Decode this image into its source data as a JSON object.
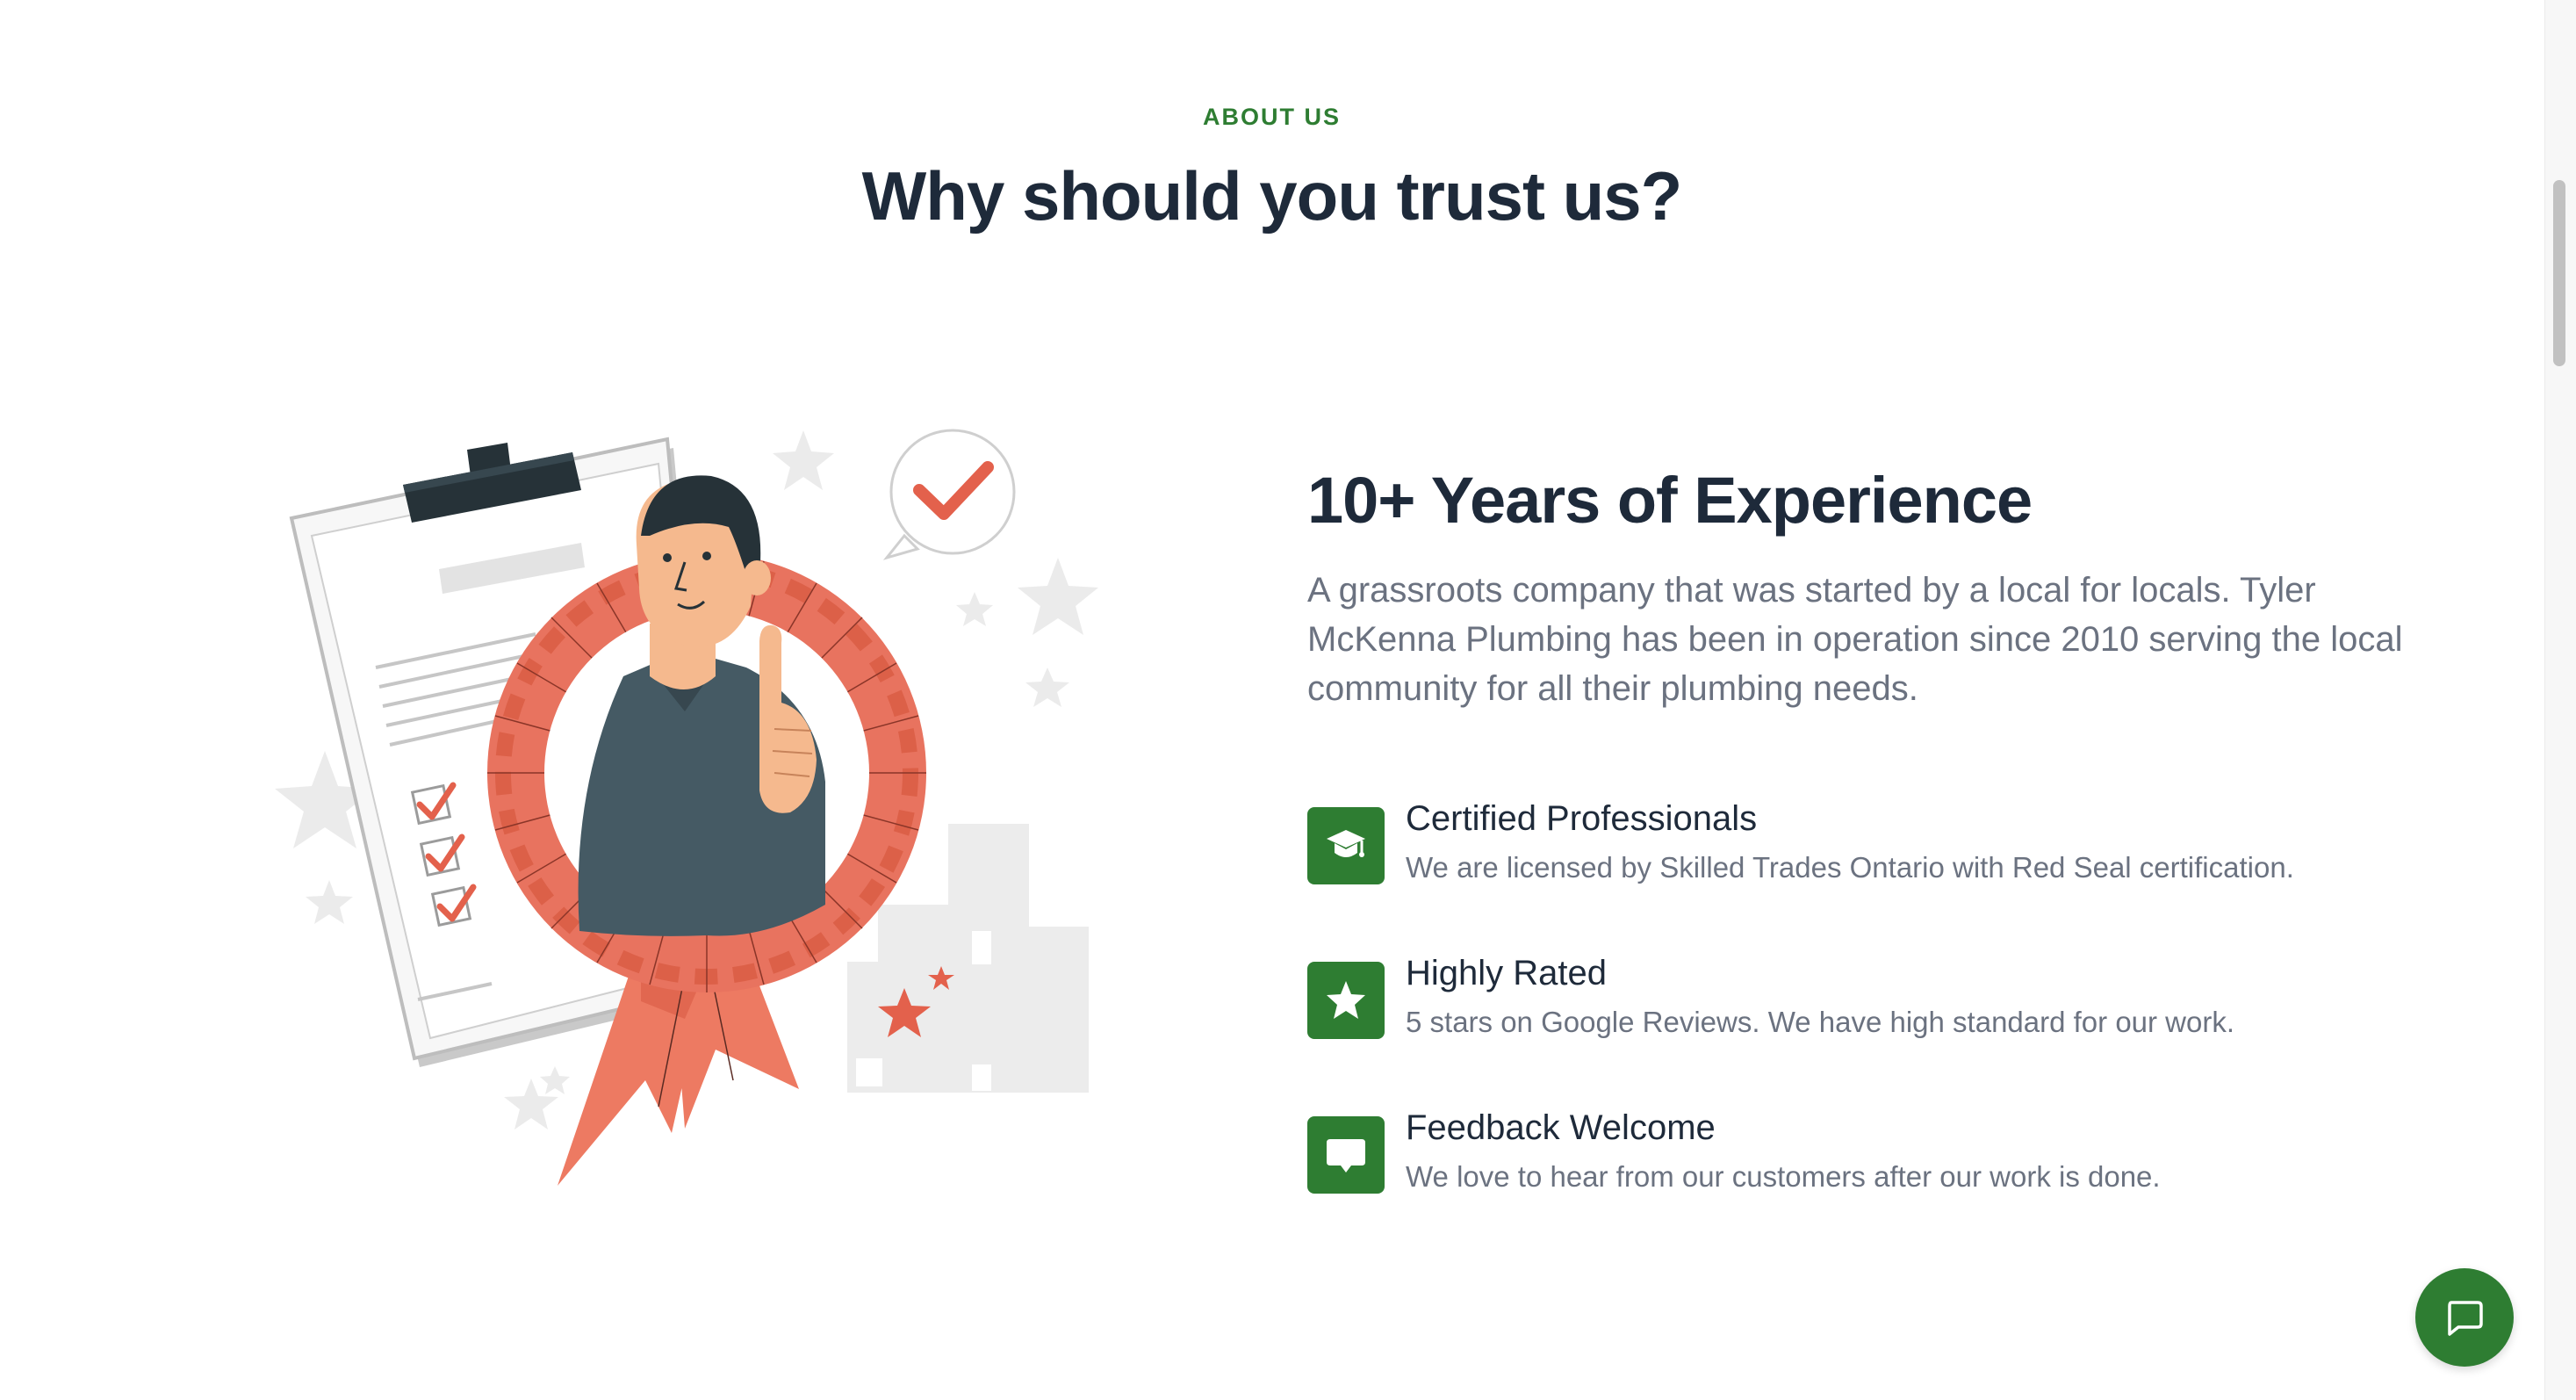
{
  "section": {
    "eyebrow": "ABOUT US",
    "title": "Why should you trust us?"
  },
  "about": {
    "heading": "10+ Years of Experience",
    "intro": "A grassroots company that was started by a local for locals. Tyler McKenna Plumbing has been in operation since 2010 serving the local community for all their plumbing needs."
  },
  "features": [
    {
      "title": "Certified Professionals",
      "description": "We are licensed by Skilled Trades Ontario with Red Seal certification.",
      "icon": "graduation-cap-icon"
    },
    {
      "title": "Highly Rated",
      "description": "5 stars on Google Reviews. We have high standard for our work.",
      "icon": "star-icon"
    },
    {
      "title": "Feedback Welcome",
      "description": "We love to hear from our customers after our work is done.",
      "icon": "speech-bubble-icon"
    }
  ],
  "chat": {
    "icon": "chat-bubble-icon"
  },
  "colors": {
    "accent": "#2e7d32",
    "heading": "#1e2a3a",
    "body_text": "#6b7280",
    "illustration_coral": "#e8735f",
    "illustration_dark": "#2f4650"
  }
}
